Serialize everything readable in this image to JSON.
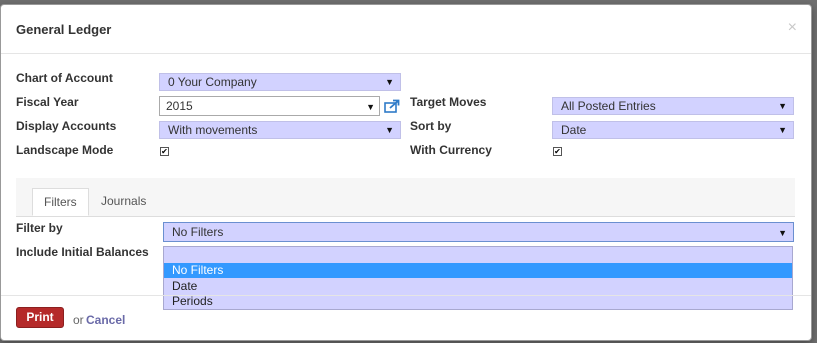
{
  "dialog": {
    "title": "General Ledger",
    "close_symbol": "×"
  },
  "fields": {
    "chart_of_account": {
      "label": "Chart of Account",
      "value": "0 Your Company"
    },
    "fiscal_year": {
      "label": "Fiscal Year",
      "value": "2015"
    },
    "display_accounts": {
      "label": "Display Accounts",
      "value": "With movements"
    },
    "landscape_mode": {
      "label": "Landscape Mode",
      "checked": true
    },
    "target_moves": {
      "label": "Target Moves",
      "value": "All Posted Entries"
    },
    "sort_by": {
      "label": "Sort by",
      "value": "Date"
    },
    "with_currency": {
      "label": "With Currency",
      "checked": true
    }
  },
  "tabs": [
    {
      "label": "Filters",
      "active": true
    },
    {
      "label": "Journals",
      "active": false
    }
  ],
  "filters": {
    "filter_by": {
      "label": "Filter by",
      "value": "No Filters"
    },
    "include_initial_balances": {
      "label": "Include Initial Balances"
    },
    "options": [
      "No Filters",
      "Date",
      "Periods"
    ],
    "highlighted_index": 0
  },
  "footer": {
    "print_label": "Print",
    "or_text": "or",
    "cancel_label": "Cancel"
  },
  "glyphs": {
    "dropdown_arrow": "▼",
    "check": "✔"
  },
  "colors": {
    "select_bg": "#d2d2ff",
    "highlight": "#3399ff",
    "print_button": "#b52a2a",
    "cancel_link": "#6a6aa8"
  }
}
